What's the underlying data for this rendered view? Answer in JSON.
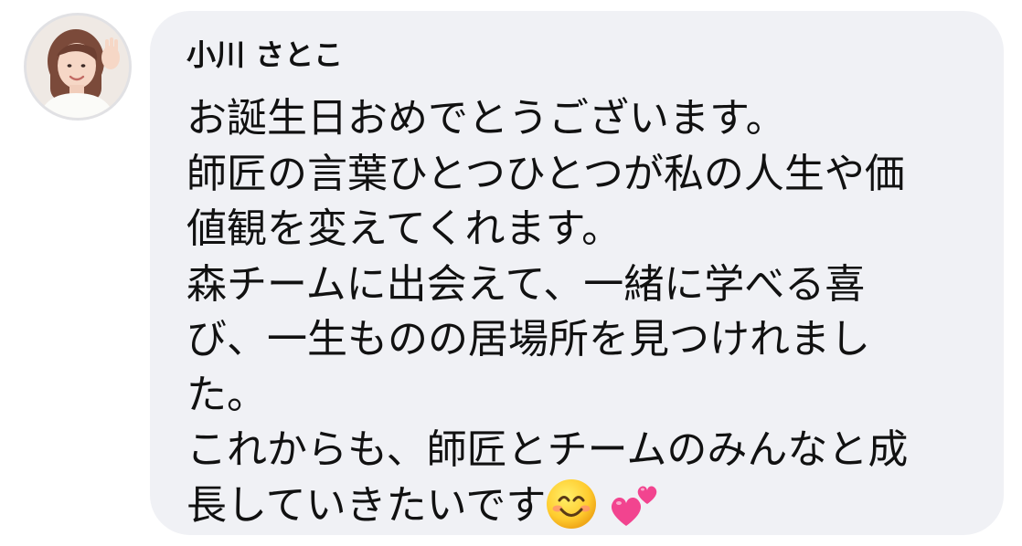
{
  "message": {
    "sender_name": "小川 さとこ",
    "lines": [
      "お誕生日おめでとうございます。",
      "師匠の言葉ひとつひとつが私の人生や価",
      "値観を変えてくれます。",
      "森チームに出会えて、一緒に学べる喜",
      "び、一生ものの居場所を見つけれまし",
      "た。",
      "これからも、師匠とチームのみんなと成",
      "長していきたいです"
    ],
    "trailing_emojis": [
      "smiling-face-with-smiling-eyes-emoji",
      "two-hearts-emoji"
    ]
  },
  "colors": {
    "bubble_background": "#f0f1f5",
    "text": "#111111",
    "avatar_border": "#e1e1e4",
    "hearts": "#f2448f"
  }
}
